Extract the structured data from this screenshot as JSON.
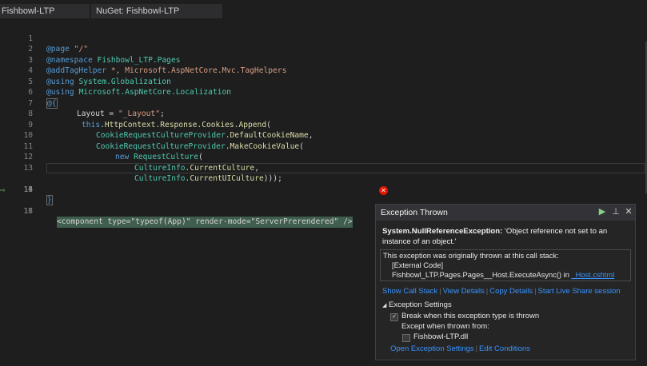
{
  "tabs": [
    {
      "label": "Fishbowl-LTP"
    },
    {
      "label": "NuGet: Fishbowl-LTP"
    }
  ],
  "editor": {
    "current_line": 14,
    "line_numbers": [
      "1",
      "2",
      "3",
      "4",
      "5",
      "6",
      "7",
      "8",
      "9",
      "10",
      "11",
      "12",
      "13",
      "14",
      "15",
      "16",
      "17"
    ],
    "lines": {
      "l1": [
        "@page",
        " ",
        "\"/\""
      ],
      "l2": [
        "@namespace",
        " ",
        "Fishbowl_LTP.Pages"
      ],
      "l3": [
        "@addTagHelper",
        " ",
        "*, Microsoft.AspNetCore.Mvc.TagHelpers"
      ],
      "l4": [
        "@using",
        " ",
        "System.Globalization"
      ],
      "l5": [
        "@using",
        " ",
        "Microsoft.AspNetCore.Localization"
      ],
      "l6": [
        "@{"
      ],
      "l7": [
        "Layout",
        " = ",
        "\"_Layout\"",
        ";"
      ],
      "l8": [
        "this",
        ".",
        "HttpContext",
        ".",
        "Response",
        ".",
        "Cookies",
        ".",
        "Append",
        "("
      ],
      "l9": [
        "CookieRequestCultureProvider",
        ".",
        "DefaultCookieName",
        ","
      ],
      "l10": [
        "CookieRequestCultureProvider",
        ".",
        "MakeCookieValue",
        "("
      ],
      "l11": [
        "new",
        " ",
        "RequestCulture",
        "("
      ],
      "l12": [
        "CultureInfo",
        ".",
        "CurrentCulture",
        ","
      ],
      "l13": [
        "CultureInfo",
        ".",
        "CurrentUICulture",
        ")));"
      ],
      "l14": [
        "}"
      ],
      "l16": [
        "<component type=\"typeof(App)\" render-mode=\"ServerPrerendered\" />"
      ]
    }
  },
  "exception": {
    "title": "Exception Thrown",
    "type": "System.NullReferenceException:",
    "message": " 'Object reference not set to an instance of an object.'",
    "stack_intro": "This exception was originally thrown at this call stack:",
    "stack_frame1": "[External Code]",
    "stack_frame2_text": "Fishbowl_LTP.Pages.Pages__Host.ExecuteAsync() in ",
    "stack_frame2_link": "_Host.cshtml",
    "links": {
      "show_call_stack": "Show Call Stack",
      "view_details": "View Details",
      "copy_details": "Copy Details",
      "live_share": "Start Live Share session"
    },
    "settings_header": "Exception Settings",
    "break_when": "Break when this exception type is thrown",
    "except_when": "Except when thrown from:",
    "module": "Fishbowl-LTP.dll",
    "open_settings": "Open Exception Settings",
    "edit_conditions": "Edit Conditions",
    "break_checked": true,
    "module_checked": false
  },
  "colors": {
    "keyword": "#569cd6",
    "type": "#4ec9b0",
    "string": "#d69d85",
    "member": "#dcdcaa",
    "highlight": "#3f5e4e",
    "link": "#3794ff"
  }
}
